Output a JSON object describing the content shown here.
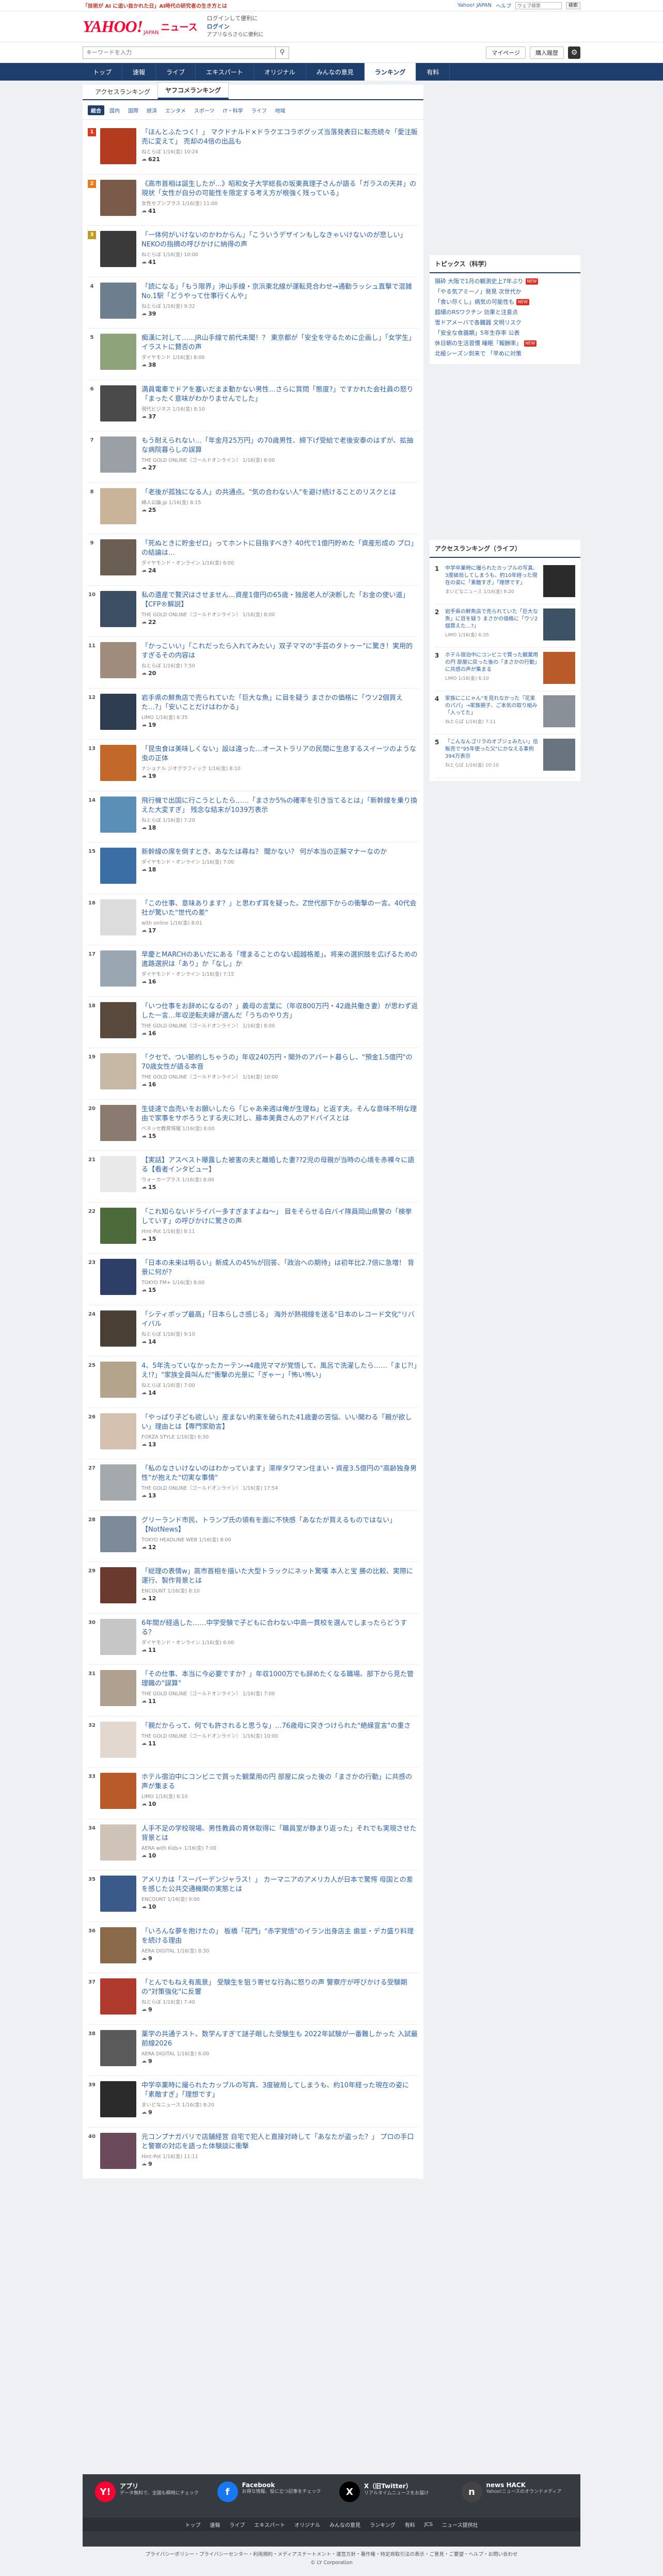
{
  "topbar": {
    "promo": "「技術が AI に追い抜かれた日」AI時代の研究者の生き方とは",
    "links": [
      "Yahoo! JAPAN",
      "ヘルプ"
    ],
    "search_placeholder": "ウェブ検索",
    "search_button": "検索"
  },
  "header": {
    "logo": "YAHOO!",
    "logo_sub": "JAPAN",
    "news": "ニュース",
    "login_line1": "ログインして便利に",
    "login_line2": "ログイン",
    "login_line3": "アプリならさらに便利に"
  },
  "search": {
    "placeholder": "キーワードを入力",
    "mypage": "マイページ",
    "purchase": "購入履歴"
  },
  "nav": [
    "トップ",
    "速報",
    "ライブ",
    "エキスパート",
    "オリジナル",
    "みんなの意見",
    "ランキング",
    "有料"
  ],
  "nav_active": "ランキング",
  "subtabs": [
    "アクセスランキング",
    "ヤフコメランキング"
  ],
  "categories": [
    "総合",
    "国内",
    "国際",
    "経済",
    "エンタメ",
    "スポーツ",
    "IT・科学",
    "ライフ",
    "地域"
  ],
  "ranking": [
    {
      "rank": "1",
      "title": "「ほんとふたつく！」 マクドナルド×ドラクエコラボグッズ当落発表日に転売続々「愛注販売に変えて」 売却の4倍の出品も",
      "meta": "ねとらぼ 1/16(金) 10:24",
      "comments": "621",
      "color": "#b33c1e"
    },
    {
      "rank": "2",
      "title": "《高市首相は誕生したが...》昭和女子大学総長の坂東眞理子さんが語る「ガラスの天井」の現状「女性が自分の可能性を限定する考え方が根強く残っている」",
      "meta": "女性セブンプラス 1/16(金) 11:00",
      "comments": "41",
      "color": "#7a5a48"
    },
    {
      "rank": "3",
      "title": "「一体何がいけないのかわからん」「こういうデザインもしなきゃいけないのが悲しい」 NEKOの指摘の呼びかけに納得の声",
      "meta": "ねとらぼ 1/16(金) 10:00",
      "comments": "41",
      "color": "#3a3a3a"
    },
    {
      "rank": "4",
      "title": "「読になる」「もう限界」沖山手線・京浜東北線が運転見合わせ→通勤ラッシュ直撃で混雑No.1駅「どうやって仕事行くんや」",
      "meta": "ねとらぼ 1/16(金) 9:32",
      "comments": "39",
      "color": "#6d7f8e"
    },
    {
      "rank": "5",
      "title": "痴漢に対して……JR山手線で前代未聞！？ 東京都が「安全を守るために企画し」「女学生」イラストに賛否の声",
      "meta": "ダイヤモンド 1/16(金) 8:00",
      "comments": "38",
      "color": "#8fa37a"
    },
    {
      "rank": "6",
      "title": "満員電車でドアを塞いだまま動かない男性…さらに質問「態度?」ですかれた会社員の怒り「まったく意味がわかりませんでした」",
      "meta": "現代ビジネス 1/16(金) 8:10",
      "comments": "37",
      "color": "#4a4a4a"
    },
    {
      "rank": "7",
      "title": "もう耐えられない…「年金月25万円」の70歳男性、締下げ受給で老後安泰のはずが、拡抽な病院暮らしの誤算",
      "meta": "THE GOLD ONLINE（ゴールドオンライン） 1/16(金) 8:00",
      "comments": "27",
      "color": "#9aa0a6"
    },
    {
      "rank": "8",
      "title": "「老後が孤独になる人」の共通点。\"気の合わない人\"を避け続けることのリスクとは",
      "meta": "婦人公論.jp 1/16(金) 8:15",
      "comments": "25",
      "color": "#c9b49a"
    },
    {
      "rank": "9",
      "title": "「死ぬときに貯金ゼロ」ってホントに目指すべき？40代で1億円貯めた「資産形成の プロ」の結論は…",
      "meta": "ダイヤモンド・オンライン 1/16(金) 6:00",
      "comments": "24",
      "color": "#6b5e52"
    },
    {
      "rank": "10",
      "title": "私の遺産で贅沢はさせません…資産1億円の65歳・独居老人が決断した「お金の使い道」【CFP®解説】",
      "meta": "THE GOLD ONLINE（ゴールドオンライン） 1/16(金) 8:00",
      "comments": "22",
      "color": "#3b4e63"
    },
    {
      "rank": "11",
      "title": "「かっこいい」「これだったら入れてみたい」双子ママの\"手芸のタトゥー\"に驚き！実用的すぎるその内容は",
      "meta": "ねとらぼ 1/16(金) 7:50",
      "comments": "20",
      "color": "#a08c7c"
    },
    {
      "rank": "12",
      "title": "岩手県の鮮魚店で売られていた「巨大な魚」に目を疑う まさかの価格に「ウソ2個買えた…?」「安いことだけはわかる」",
      "meta": "LIMO 1/16(金) 6:35",
      "comments": "19",
      "color": "#2e3e50"
    },
    {
      "rank": "13",
      "title": "「昆虫食は美味しくない」設は違った…オーストラリアの民間に生息するスイーツのような虫の正体",
      "meta": "ナショナル ジオグラフィック 1/16(金) 8:10",
      "comments": "19",
      "color": "#c2682a"
    },
    {
      "rank": "14",
      "title": "飛行機で出国に行こうとしたら……「まさか5%の確率を引き当てるとは」「新幹線を乗り換えた大変すぎ」 残念な結末が1039万表示",
      "meta": "ねとらぼ 1/16(金) 7:20",
      "comments": "18",
      "color": "#5b8fb5"
    },
    {
      "rank": "15",
      "title": "新幹線の席を倒すとき、あなたは尋ね？ 聞かない？ 何が本当の正解マナーなのか",
      "meta": "ダイヤモンド・オンライン 1/16(金) 7:00",
      "comments": "18",
      "color": "#3a6ea5"
    },
    {
      "rank": "16",
      "title": "「この仕事、意味あります？」と思わず耳を疑った。Z世代部下からの衝撃の一言。40代会社が驚いた\"世代の差\"",
      "meta": "with online 1/16(金) 8:01",
      "comments": "17",
      "color": "#dcdcdc"
    },
    {
      "rank": "17",
      "title": "早慶とMARCHのあいだにある「埋まることのない超越格差」。将来の選択肢を広げるための進路選択は「あり」か「なし」か",
      "meta": "ダイヤモンド・オンライン 1/16(金) 7:15",
      "comments": "16",
      "color": "#9aa7b2"
    },
    {
      "rank": "18",
      "title": "「いつ仕事をお辞めになるの？」義母の言葉に（年収800万円・42歳共働き妻）が思わず返した一言…年収逆転夫婦が選んだ「うちのやり方」",
      "meta": "THE GOLD ONLINE（ゴールドオンライン） 1/16(金) 8:00",
      "comments": "16",
      "color": "#5a4a3e"
    },
    {
      "rank": "19",
      "title": "「クセで、つい節約しちゃうの」年収240万円・関外のアパート暮らし、\"預金1.5億円\"の70歳女性が語る本音",
      "meta": "THE GOLD ONLINE（ゴールドオンライン） 1/16(金) 10:00",
      "comments": "16",
      "color": "#c7b8a6"
    },
    {
      "rank": "20",
      "title": "生徒達で血売いをお願いしたら「じゃあ来週は俺が生理ね」と返す夫。そんな意味不明な理由で家事をサボろうとする夫に対し、藤本美貴さんのアドバイスとは",
      "meta": "ベネッセ教育情報 1/16(金) 8:00",
      "comments": "15",
      "color": "#8a7a70"
    },
    {
      "rank": "21",
      "title": "【実話】アスベスト曝露した被害の夫と離婚した妻??2児の母親が当時の心境を赤裸々に語る【看者インタビュー】",
      "meta": "ウォーカープラス 1/16(金) 8:00",
      "comments": "15",
      "color": "#e9e9e9"
    },
    {
      "rank": "22",
      "title": "「これ知らないドライバー多すぎますよね～」 目をそらせる白バイ隊員岡山県警の「検挙していす」の呼びかけに驚きの声",
      "meta": "Hint-Pot 1/16(金) 8:11",
      "comments": "15",
      "color": "#4d6a3a"
    },
    {
      "rank": "23",
      "title": "「日本の未来は明るい」新成人の45%が回答、「政治への期待」は初年比2.7倍に急増！ 背景に何が？",
      "meta": "TOKYO FM+ 1/16(金) 8:00",
      "comments": "15",
      "color": "#2d3f66"
    },
    {
      "rank": "24",
      "title": "「シティポップ最高」「日本らしさ感じる」 海外が熱視線を送る\"日本のレコード文化\"リバイバル",
      "meta": "ねとらぼ 1/16(金) 9:10",
      "comments": "14",
      "color": "#4a3f34"
    },
    {
      "rank": "25",
      "title": "4、5年洗っていなかったカーテン→4歳児ママが覚悟して、風呂で洗濯したら……「まじ?!」え!?」\"家族全員叫んだ\"衝撃の光景に「ぎゃー」「怖い怖い」",
      "meta": "ねとらぼ 1/16(金) 7:00",
      "comments": "14",
      "color": "#b4a48c"
    },
    {
      "rank": "26",
      "title": "「やっぱり子ども欲しい」産まない約束を破られた41歳妻の苦悩、いい関わる「親が欲しい」理由とは【専門家助言】",
      "meta": "FORZA STYLE 1/16(金) 6:30",
      "comments": "13",
      "color": "#d4c1b0"
    },
    {
      "rank": "27",
      "title": "「私のなさいけないのはわかっています」滞岸タワマン住まい・資産3.5億円の\"高齢独身男性\"が抱えた\"切実な事情\"",
      "meta": "THE GOLD ONLINE（ゴールドオンライン） 1/16(金) 17:54",
      "comments": "13",
      "color": "#a3a9ad"
    },
    {
      "rank": "28",
      "title": "グリーランド市民、トランプ氏の領有を面に不快感「あなたが買えるものではない」【NotNews】",
      "meta": "TOKYO HEADLINE WEB 1/16(金) 8:00",
      "comments": "12",
      "color": "#7c8a99"
    },
    {
      "rank": "29",
      "title": "「総理の表情w」高市首相を描いた大型トラックにネット驚嘆 本人と宝 勝の比較、実際に運行、製作背景とは",
      "meta": "ENCOUNT 1/16(金) 8:10",
      "comments": "12",
      "color": "#6a3a2e"
    },
    {
      "rank": "30",
      "title": "6年間が経過した……中学受験で子どもに合わない中高一貫校を選んでしまったらどうする？",
      "meta": "ダイヤモンド・オンライン 1/16(金) 6:00",
      "comments": "11",
      "color": "#c6c6c6"
    },
    {
      "rank": "31",
      "title": "「その仕事、本当に今必要ですか？」年収1000万でも辞めたくなる職場、部下から見た管理職の\"誤算\"",
      "meta": "THE GOLD ONLINE（ゴールドオンライン） 1/16(金) 7:00",
      "comments": "11",
      "color": "#b0a090"
    },
    {
      "rank": "32",
      "title": "「親だからって、何でも許されると思うな」…76歳母に突きつけられた\"絶縁宣言\"の重さ",
      "meta": "THE GOLD ONLINE（ゴールドオンライン） 1/16(金) 10:00",
      "comments": "11",
      "color": "#e3d8cf"
    },
    {
      "rank": "33",
      "title": "ホテル宿泊中にコンビニで買った観葉用の円 部屋に戻った後の「まさかの行動」に共感の声が集まる",
      "meta": "LIMO 1/16(金) 6:10",
      "comments": "10",
      "color": "#b85a2a"
    },
    {
      "rank": "34",
      "title": "人手不足の学校現場、男性教員の育休取得に「職員室が静まり返った」それでも実現させた背景とは",
      "meta": "AERA with Kids+ 1/16(金) 7:00",
      "comments": "10",
      "color": "#cfc3b8"
    },
    {
      "rank": "35",
      "title": "アメリカは「スーパーデンジャラス！」 カーマニアのアメリカ人が日本で驚愕 母国との差を感じた公共交通機関の実態とは",
      "meta": "ENCOUNT 1/16(金) 9:00",
      "comments": "10",
      "color": "#3a5a8a"
    },
    {
      "rank": "36",
      "title": "「いろんな夢を抱けたの」 板橋「花門」\"赤字覚悟\"のイラン出身店主 歯並・デカ盛り料理を続ける理由",
      "meta": "AERA DIGITAL 1/16(金) 8:30",
      "comments": "9",
      "color": "#8a6a4a"
    },
    {
      "rank": "37",
      "title": "「とんでもねえ有風景」 受験生を狙う寄せな行為に怒りの声 警察庁が呼びかける受験期の\"対策強化\"に反響",
      "meta": "ねとらぼ 1/16(金) 7:40",
      "comments": "9",
      "color": "#b03a2e"
    },
    {
      "rank": "38",
      "title": "薬学の共通テスト、数学んすぎて謎子眼した受験生も 2022年試験が一番難しかった 入試最前線2026",
      "meta": "AERA DIGITAL 1/16(金) 6:00",
      "comments": "9",
      "color": "#5a5a5a"
    },
    {
      "rank": "39",
      "title": "中学卒業時に撮られたカップルの写真、3度破局してしまうも、約10年経った現在の姿に「素敵すぎ」「理想です」",
      "meta": "まいどなニュース 1/16(金) 8:20",
      "comments": "9",
      "color": "#2b2b2b"
    },
    {
      "rank": "40",
      "title": "元コンプナガバリで店舗経営 自宅で犯人と直接対峙して「あなたが盗った？」 プロの手口と警察の対応を語った体験談に衝撃",
      "meta": "Hint-Pot 1/16(金) 11:11",
      "comments": "9",
      "color": "#6a4a5a"
    }
  ],
  "topics": {
    "heading": "トピックス（科学）",
    "items": [
      {
        "text": "隕砕 大阪で1月の観測史上7年ぶり",
        "new": true
      },
      {
        "text": "「やる気アミーノ」発見 次世代か",
        "new": false
      },
      {
        "text": "「食い尽くし」病気の可能性も",
        "new": true
      },
      {
        "text": "超細のRSワクチン 効果と注意点",
        "new": false
      },
      {
        "text": "雪ドアメーバで各臓器 文明リスク",
        "new": false
      },
      {
        "text": "「安全な食器類」5年生存率 公表",
        "new": false
      },
      {
        "text": "休日朝の生活習慣 睡眠「報酬率」",
        "new": true
      },
      {
        "text": "北極シーズン到来で 「早めに対策",
        "new": false
      }
    ]
  },
  "life": {
    "heading": "アクセスランキング（ライフ）",
    "items": [
      {
        "rank": "1",
        "title": "中学卒業時に撮られたカップルの写真、3度破局してしまうも、約10年経った現在の姿に「素敵すぎ」「理想です」",
        "meta": "まいどなニュース 1/16(金) 8:20",
        "color": "#2b2b2b"
      },
      {
        "rank": "2",
        "title": "岩手県の鮮魚店で売られていた「巨大な魚」に目を疑う まさかの価格に「ウソ2個買えた…?」",
        "meta": "LIMO 1/16(金) 6:35",
        "color": "#3e5266"
      },
      {
        "rank": "3",
        "title": "ホテル宿泊中にコンビニで買った観葉用の円 部屋に戻った後の「まさかの行動」に共感の声が集まる",
        "meta": "LIMO 1/16(金) 6:10",
        "color": "#b85a2a"
      },
      {
        "rank": "4",
        "title": "家族にこにゃん\"を見れなかった「花束のパパ」→家族親子、ご本気の取り組み「入ってた」",
        "meta": "ねとらぼ 1/16(金) 7:11",
        "color": "#8a9098"
      },
      {
        "rank": "5",
        "title": "「こんなんゴリラのオブジェみたい」信販売で\"95年使った父\"にかなえる事例 394万表示",
        "meta": "ねとらぼ 1/16(金) 10:10",
        "color": "#6a7480"
      }
    ]
  },
  "footer": {
    "cols": [
      {
        "name": "アプリ",
        "desc": "データ無料で、全国も瞬時にチェック",
        "icon": "Y!",
        "color": "#ff0033"
      },
      {
        "name": "Facebook",
        "desc": "お得な情報、役に立つ記事をチェック",
        "icon": "f",
        "color": "#1877f2"
      },
      {
        "name": "X（旧Twitter）",
        "desc": "リアルタイムニュースをお届け",
        "icon": "X",
        "color": "#000000"
      },
      {
        "name": "news HACK",
        "desc": "Yahoo!ニュースのオウンドメディア",
        "icon": "n",
        "color": "#444444"
      }
    ],
    "nav": [
      "トップ",
      "速報",
      "ライブ",
      "エキスパート",
      "オリジナル",
      "みんなの意見",
      "ランキング",
      "有料",
      "JCS",
      "ニュース提供社"
    ],
    "legal": "プライバシーポリシー・プライバシーセンター・利用規約・メディアステートメント・運営方針・著作権・特定商取引法の表示・ご意見・ご要望・ヘルプ・お問い合わせ",
    "copyright": "© LY Corporation"
  }
}
